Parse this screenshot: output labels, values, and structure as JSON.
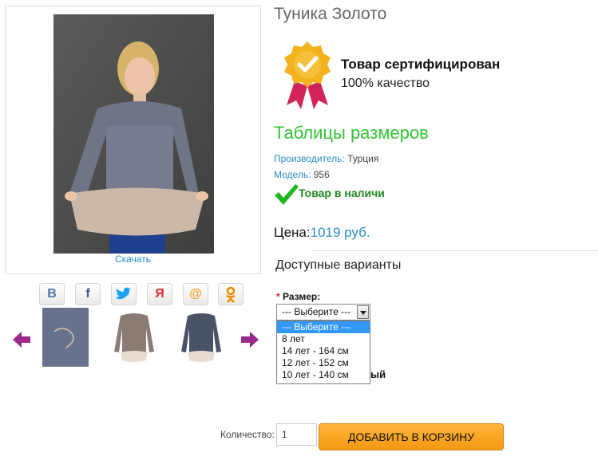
{
  "product": {
    "title": "Туника Золото",
    "image_link": "Скачать"
  },
  "certificate": {
    "title": "Товар сертифицирован",
    "subtitle": "100% качество"
  },
  "size_table_link": "Таблицы размеров",
  "meta": {
    "manufacturer_label": "Производитель:",
    "manufacturer_value": " Турция",
    "model_label": "Модель:",
    "model_value": " 956"
  },
  "stock_status": "Товар в наличи",
  "price": {
    "label": "Цена:",
    "value": "1019 руб."
  },
  "variants_heading": "Доступные варианты",
  "size_field": {
    "required_mark": "*",
    "label": " Размер:",
    "selected": "--- Выберите ---",
    "options": [
      "--- Выберите ---",
      "8 лет",
      "14 лет - 164 см",
      "12 лет - 152 см",
      "10 лет - 140 см"
    ],
    "obscured_text": "ый"
  },
  "quantity": {
    "label": "Количество:",
    "value": "1"
  },
  "cart_button": "ДОБАВИТЬ В КОРЗИНУ",
  "share_icons": [
    "vk-icon",
    "facebook-icon",
    "twitter-icon",
    "odnoklassniki-icon",
    "mailru-icon",
    "ok-icon"
  ],
  "colors": {
    "link": "#2a8ec7",
    "green_heading": "#33c633",
    "stock_green": "#1f8a1f",
    "cart_orange": "#f49812",
    "arrow_purple": "#9a2a8c"
  }
}
